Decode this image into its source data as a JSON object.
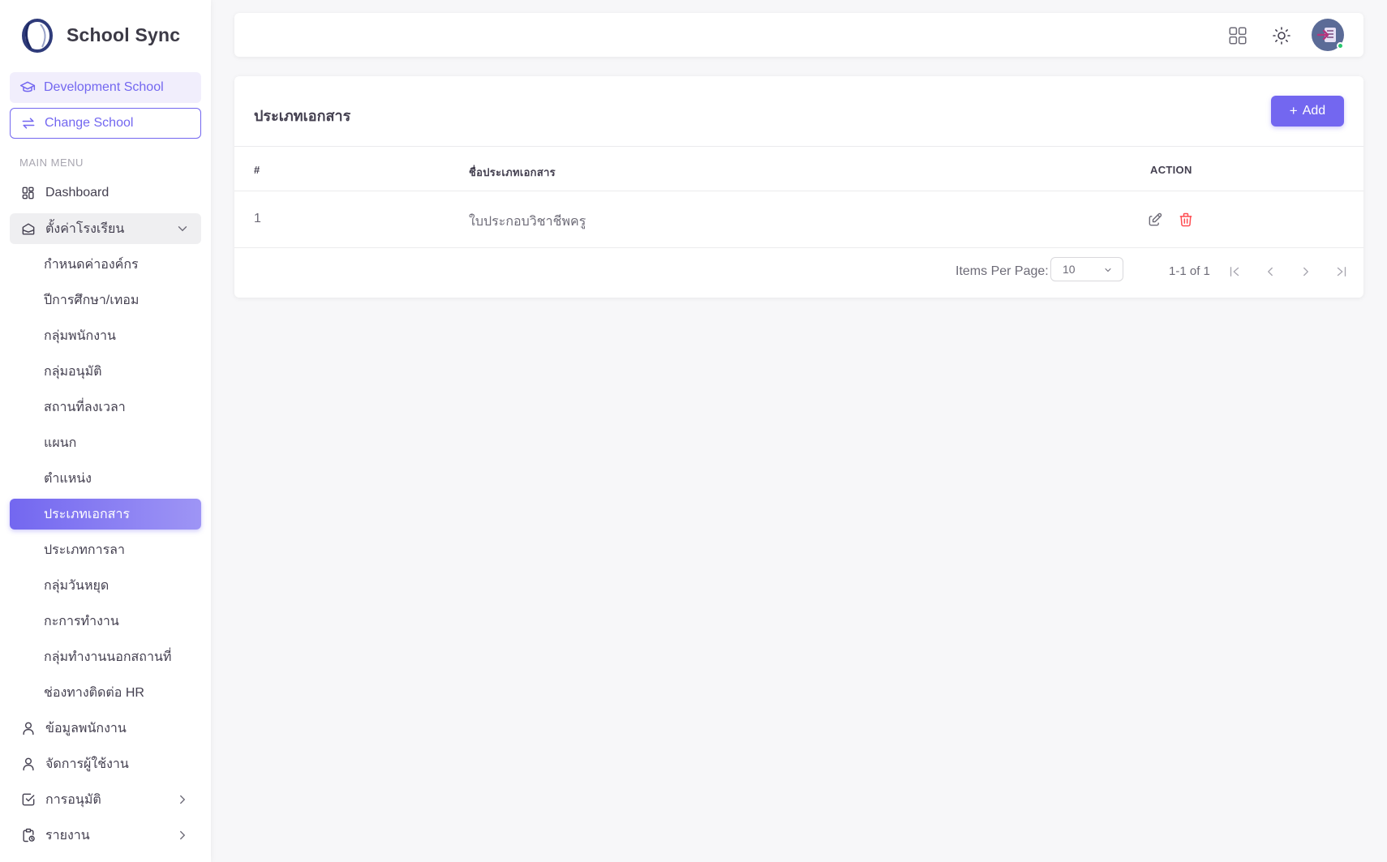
{
  "app": {
    "name": "School Sync",
    "logo_icon": "school-sync-logo"
  },
  "sidebar": {
    "school_name": "Development School",
    "school_icon": "graduation-cap-icon",
    "change_school_label": "Change School",
    "change_icon": "swap-icon",
    "menu_header": "MAIN MENU",
    "items": [
      {
        "label": "Dashboard",
        "icon": "dashboard-icon"
      },
      {
        "label": "ตั้งค่าโรงเรียน",
        "icon": "school-icon",
        "expanded": true
      }
    ],
    "submenu": [
      {
        "label": "กำหนดค่าองค์กร"
      },
      {
        "label": "ปีการศึกษา/เทอม"
      },
      {
        "label": "กลุ่มพนักงาน"
      },
      {
        "label": "กลุ่มอนุมัติ"
      },
      {
        "label": "สถานที่ลงเวลา"
      },
      {
        "label": "แผนก"
      },
      {
        "label": "ตำแหน่ง"
      },
      {
        "label": "ประเภทเอกสาร",
        "active": true
      },
      {
        "label": "ประเภทการลา"
      },
      {
        "label": "กลุ่มวันหยุด"
      },
      {
        "label": "กะการทำงาน"
      },
      {
        "label": "กลุ่มทำงานนอกสถานที่"
      },
      {
        "label": "ช่องทางติดต่อ HR"
      }
    ],
    "bottom_items": [
      {
        "label": "ข้อมูลพนักงาน",
        "icon": "user-icon"
      },
      {
        "label": "จัดการผู้ใช้งาน",
        "icon": "user-icon"
      },
      {
        "label": "การอนุมัติ",
        "icon": "checkbox-icon"
      },
      {
        "label": "รายงาน",
        "icon": "clipboard-report-icon"
      }
    ]
  },
  "navbar": {
    "icons": [
      "apps-grid-icon",
      "sun-icon",
      "user-avatar"
    ],
    "status": "online"
  },
  "page": {
    "title": "ประเภทเอกสาร",
    "add_label": "Add",
    "table": {
      "columns": [
        "#",
        "ชื่อประเภทเอกสาร",
        "ACTION"
      ],
      "rows": [
        {
          "index": "1",
          "name": "ใบประกอบวิชาชีพครู",
          "actions": [
            "edit-icon",
            "delete-icon"
          ]
        }
      ]
    },
    "pagination": {
      "items_per_page_label": "Items Per Page:",
      "items_per_page_value": "10",
      "range": "1-1 of 1"
    }
  },
  "colors": {
    "primary": "#7367f0",
    "danger": "#ff4c51",
    "text": "#444050",
    "background": "#f7f7f9"
  }
}
